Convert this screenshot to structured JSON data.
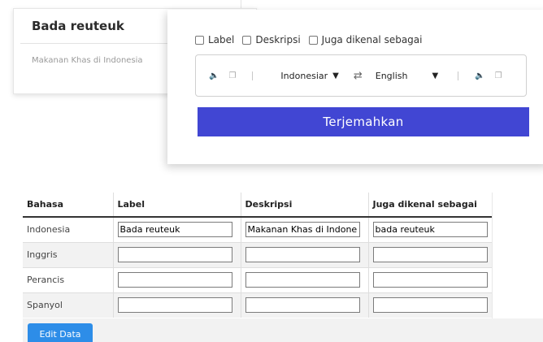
{
  "entity": {
    "title": "Bada reuteuk",
    "description": "Makanan Khas di Indonesia"
  },
  "translator": {
    "options": [
      "Label",
      "Deskripsi",
      "Juga dikenal sebagai"
    ],
    "source_lang": "Indonesiar",
    "target_lang": "English",
    "swap_icon": "swap-arrows-icon",
    "speaker_icon": "speaker-icon",
    "copy_icon": "copy-icon",
    "translate_label": "Terjemahkan"
  },
  "table": {
    "headers": [
      "Bahasa",
      "Label",
      "Deskripsi",
      "Juga dikenal sebagai"
    ],
    "rows": [
      {
        "lang": "Indonesia",
        "label": "Bada reuteuk",
        "desc": "Makanan Khas di Indone",
        "aka": "bada reuteuk"
      },
      {
        "lang": "Inggris",
        "label": "",
        "desc": "",
        "aka": ""
      },
      {
        "lang": "Perancis",
        "label": "",
        "desc": "",
        "aka": ""
      },
      {
        "lang": "Spanyol",
        "label": "",
        "desc": "",
        "aka": ""
      }
    ]
  },
  "edit_label": "Edit Data",
  "colors": {
    "primary_button": "#4146d3",
    "edit_button": "#2d8de8"
  }
}
